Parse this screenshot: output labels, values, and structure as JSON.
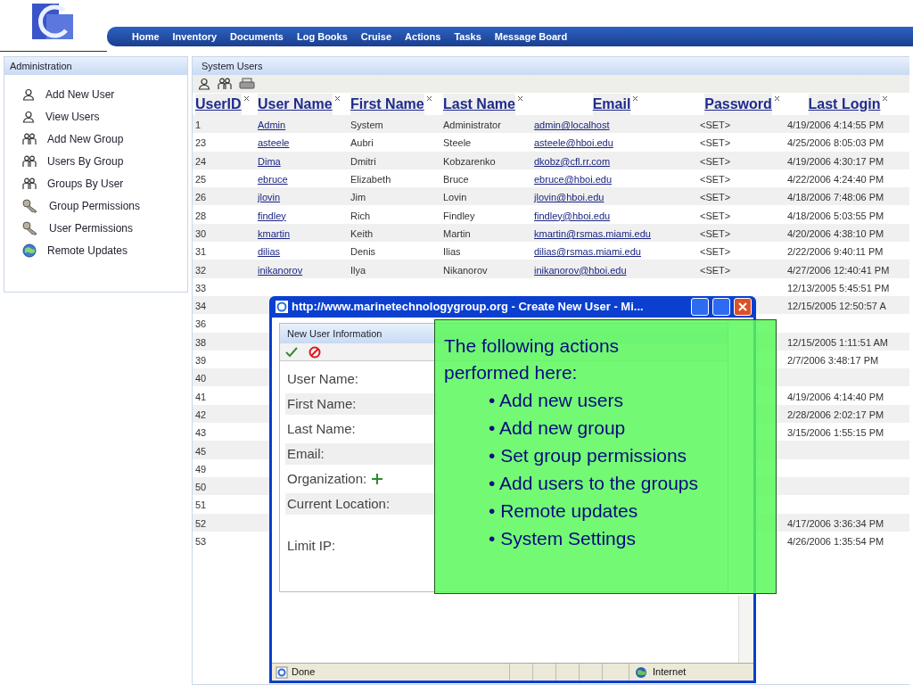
{
  "nav": {
    "items": [
      "Home",
      "Inventory",
      "Documents",
      "Log Books",
      "Cruise",
      "Actions",
      "Tasks",
      "Message Board"
    ]
  },
  "sidebar": {
    "title": "Administration",
    "items": [
      {
        "label": "Add New User",
        "kind": "user"
      },
      {
        "label": "View Users",
        "kind": "user"
      },
      {
        "label": "Add New Group",
        "kind": "group"
      },
      {
        "label": "Users By Group",
        "kind": "group"
      },
      {
        "label": "Groups By User",
        "kind": "group"
      },
      {
        "label": "Group Permissions",
        "kind": "key"
      },
      {
        "label": "User Permissions",
        "kind": "key"
      },
      {
        "label": "Remote Updates",
        "kind": "globe"
      }
    ]
  },
  "main": {
    "title": "System Users",
    "columns": [
      "UserID",
      "User Name",
      "First Name",
      "Last Name",
      "Email",
      "Password",
      "Last Login"
    ],
    "rows": [
      {
        "user_id": "1",
        "user_name": "Admin",
        "first_name": "System",
        "last_name": "Administrator",
        "email": "admin@localhost",
        "password": "<SET>",
        "last_login": "4/19/2006 4:14:55 PM"
      },
      {
        "user_id": "23",
        "user_name": "asteele",
        "first_name": "Aubri",
        "last_name": "Steele",
        "email": "asteele@hboi.edu",
        "password": "<SET>",
        "last_login": "4/25/2006 8:05:03 PM"
      },
      {
        "user_id": "24",
        "user_name": "Dima",
        "first_name": "Dmitri",
        "last_name": "Kobzarenko",
        "email": "dkobz@cfl.rr.com",
        "password": "<SET>",
        "last_login": "4/19/2006 4:30:17 PM"
      },
      {
        "user_id": "25",
        "user_name": "ebruce",
        "first_name": "Elizabeth",
        "last_name": "Bruce",
        "email": "ebruce@hboi.edu",
        "password": "<SET>",
        "last_login": "4/22/2006 4:24:40 PM"
      },
      {
        "user_id": "26",
        "user_name": "jlovin",
        "first_name": "Jim",
        "last_name": "Lovin",
        "email": "jlovin@hboi.edu",
        "password": "<SET>",
        "last_login": "4/18/2006 7:48:06 PM"
      },
      {
        "user_id": "28",
        "user_name": "findley",
        "first_name": "Rich",
        "last_name": "Findley",
        "email": "findley@hboi.edu",
        "password": "<SET>",
        "last_login": "4/18/2006 5:03:55 PM"
      },
      {
        "user_id": "30",
        "user_name": "kmartin",
        "first_name": "Keith",
        "last_name": "Martin",
        "email": "kmartin@rsmas.miami.edu",
        "password": "<SET>",
        "last_login": "4/20/2006 4:38:10 PM"
      },
      {
        "user_id": "31",
        "user_name": "dilias",
        "first_name": "Denis",
        "last_name": "Ilias",
        "email": "dilias@rsmas.miami.edu",
        "password": "<SET>",
        "last_login": "2/22/2006 9:40:11 PM"
      },
      {
        "user_id": "32",
        "user_name": "inikanorov",
        "first_name": "Ilya",
        "last_name": "Nikanorov",
        "email": "inikanorov@hboi.edu",
        "password": "<SET>",
        "last_login": "4/27/2006 12:40:41 PM"
      },
      {
        "user_id": "33",
        "last_login": "12/13/2005 5:45:51 PM"
      },
      {
        "user_id": "34",
        "last_login": "12/15/2005 12:50:57 A"
      },
      {
        "user_id": "36"
      },
      {
        "user_id": "38",
        "last_login": "12/15/2005 1:11:51 AM"
      },
      {
        "user_id": "39",
        "last_login": "2/7/2006 3:48:17 PM"
      },
      {
        "user_id": "40"
      },
      {
        "user_id": "41",
        "last_login": "4/19/2006 4:14:40 PM"
      },
      {
        "user_id": "42",
        "last_login": "2/28/2006 2:02:17 PM"
      },
      {
        "user_id": "43",
        "last_login": "3/15/2006 1:55:15 PM"
      },
      {
        "user_id": "45"
      },
      {
        "user_id": "49"
      },
      {
        "user_id": "50"
      },
      {
        "user_id": "51"
      },
      {
        "user_id": "52",
        "last_login": "4/17/2006 3:36:34 PM"
      },
      {
        "user_id": "53",
        "last_login": "4/26/2006 1:35:54 PM"
      }
    ]
  },
  "popup": {
    "title": "http://www.marinetechnologygroup.org - Create New User - Mi...",
    "panel_title": "New User Information",
    "fields": [
      {
        "label": "User Name:",
        "kind": "text"
      },
      {
        "label": "First Name:",
        "kind": "text"
      },
      {
        "label": "Last Name:",
        "kind": "text"
      },
      {
        "label": "Email:",
        "kind": "text"
      },
      {
        "label": "Organization:",
        "kind": "add"
      },
      {
        "label": "Current Location:",
        "kind": "text"
      },
      {
        "label": "Limit IP:",
        "kind": "textarea"
      }
    ],
    "status": "Done",
    "zone": "Internet"
  },
  "callout": {
    "intro": "The following actions performed here:",
    "bullets": [
      "• Add new users",
      "• Add new group",
      "• Set group permissions",
      "• Add users to the groups",
      "• Remote updates",
      "• System Settings"
    ]
  }
}
